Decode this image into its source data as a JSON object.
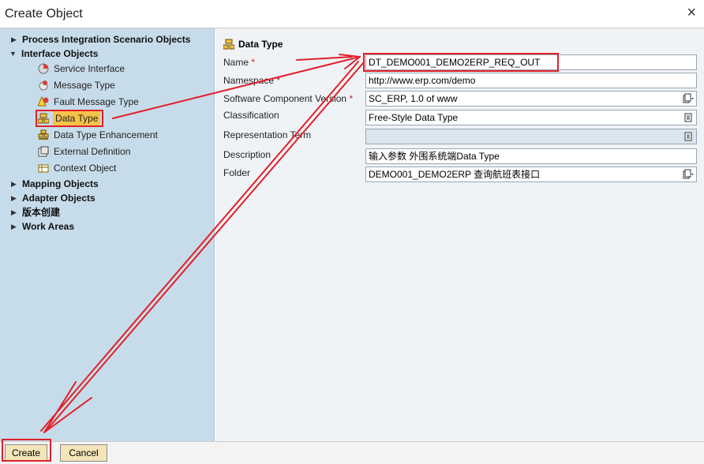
{
  "window": {
    "title": "Create Object",
    "close_label": "×"
  },
  "tree": {
    "groups": [
      {
        "label": "Process Integration Scenario Objects",
        "expanded": false
      },
      {
        "label": "Interface Objects",
        "expanded": true
      },
      {
        "label": "Mapping Objects",
        "expanded": false
      },
      {
        "label": "Adapter Objects",
        "expanded": false
      },
      {
        "label": "版本创建",
        "expanded": false
      },
      {
        "label": "Work Areas",
        "expanded": false
      }
    ],
    "interface_children": [
      {
        "label": "Service Interface",
        "icon": "service-interface-icon"
      },
      {
        "label": "Message Type",
        "icon": "message-type-icon"
      },
      {
        "label": "Fault Message Type",
        "icon": "fault-message-type-icon"
      },
      {
        "label": "Data Type",
        "icon": "data-type-icon",
        "selected": true
      },
      {
        "label": "Data Type Enhancement",
        "icon": "data-type-enhancement-icon"
      },
      {
        "label": "External Definition",
        "icon": "external-definition-icon"
      },
      {
        "label": "Context Object",
        "icon": "context-object-icon"
      }
    ]
  },
  "form": {
    "title": "Data Type",
    "required_mark": "*",
    "fields": [
      {
        "label": "Name",
        "required": true,
        "value": "DT_DEMO001_DEMO2ERP_REQ_OUT"
      },
      {
        "label": "Namespace",
        "required": true,
        "value": "http://www.erp.com/demo"
      },
      {
        "label": "Software Component Version",
        "required": true,
        "value": "SC_ERP, 1.0 of www"
      },
      {
        "label": "Classification",
        "required": false,
        "value": "Free-Style Data Type"
      },
      {
        "label": "Representation Term",
        "required": false,
        "value": ""
      },
      {
        "label": "Description",
        "required": false,
        "value": "输入参数 外围系统端Data Type"
      },
      {
        "label": "Folder",
        "required": false,
        "value": "DEMO001_DEMO2ERP 查询航班表接口"
      }
    ]
  },
  "buttons": {
    "create": "Create",
    "cancel": "Cancel"
  },
  "colors": {
    "tree_bg": "#c7dcea",
    "form_bg": "#f0f3f6",
    "highlight": "#e0202a",
    "selected": "#f6c34a",
    "button": "#f3e4b9"
  }
}
